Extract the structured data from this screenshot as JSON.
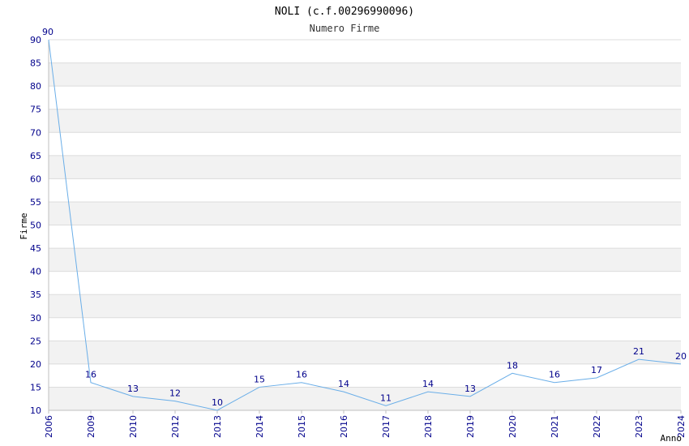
{
  "chart_data": {
    "type": "line",
    "title": "NOLI (c.f.00296990096)",
    "subtitle": "Numero Firme",
    "xlabel": "Anno",
    "ylabel": "Firme",
    "categories": [
      "2006",
      "2009",
      "2010",
      "2012",
      "2013",
      "2014",
      "2015",
      "2016",
      "2017",
      "2018",
      "2019",
      "2020",
      "2021",
      "2022",
      "2023",
      "2024"
    ],
    "series": [
      {
        "values": [
          90,
          16,
          13,
          12,
          10,
          15,
          16,
          14,
          11,
          14,
          13,
          18,
          16,
          17,
          21,
          20
        ]
      }
    ],
    "ylim": [
      10,
      90
    ],
    "ytick_step": 5,
    "grid": true,
    "colors": {
      "line": "#6aaee8",
      "band": "#f2f2f2",
      "grid": "#dcdcdc",
      "tick": "#00008b"
    }
  }
}
